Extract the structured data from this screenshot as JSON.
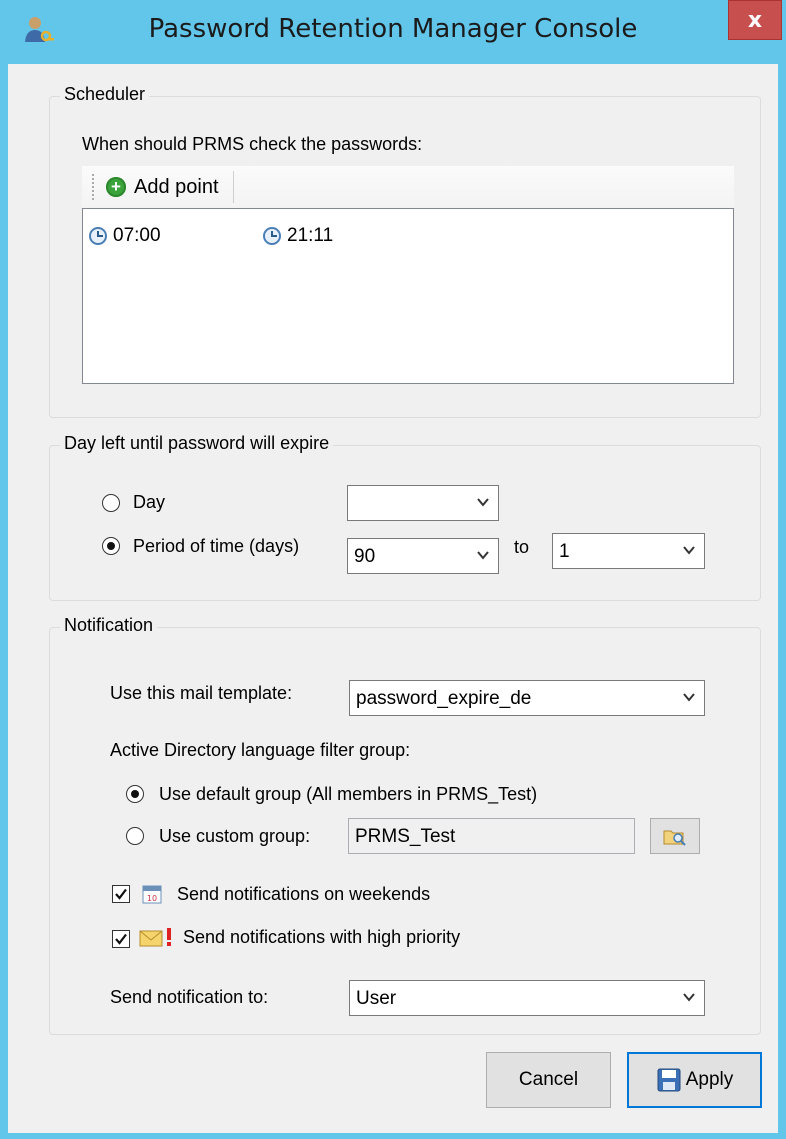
{
  "window": {
    "title": "Password Retention Manager Console",
    "close_label": "x"
  },
  "scheduler": {
    "legend": "Scheduler",
    "prompt": "When should PRMS check the passwords:",
    "add_point_label": "Add point",
    "times": [
      "07:00",
      "21:11"
    ]
  },
  "expiry": {
    "legend": "Day left until password will expire",
    "day_label": "Day",
    "day_value": "",
    "period_label": "Period of time (days)",
    "period_from": "90",
    "to_label": "to",
    "period_to": "1",
    "selected": "period"
  },
  "notification": {
    "legend": "Notification",
    "template_label": "Use this mail template:",
    "template_value": "password_expire_de",
    "ad_group_label": "Active Directory language filter group:",
    "default_group_label": "Use default group (All members in PRMS_Test)",
    "custom_group_label": "Use custom group:",
    "custom_group_value": "PRMS_Test",
    "weekends_label": "Send notifications on weekends",
    "weekends_checked": true,
    "high_priority_label": "Send notifications with high priority",
    "high_priority_checked": true,
    "send_to_label": "Send notification to:",
    "send_to_value": "User"
  },
  "buttons": {
    "cancel": "Cancel",
    "apply": "Apply"
  },
  "colors": {
    "titlebar": "#62c6eb",
    "close": "#c7504f",
    "client": "#f0f0f0"
  }
}
